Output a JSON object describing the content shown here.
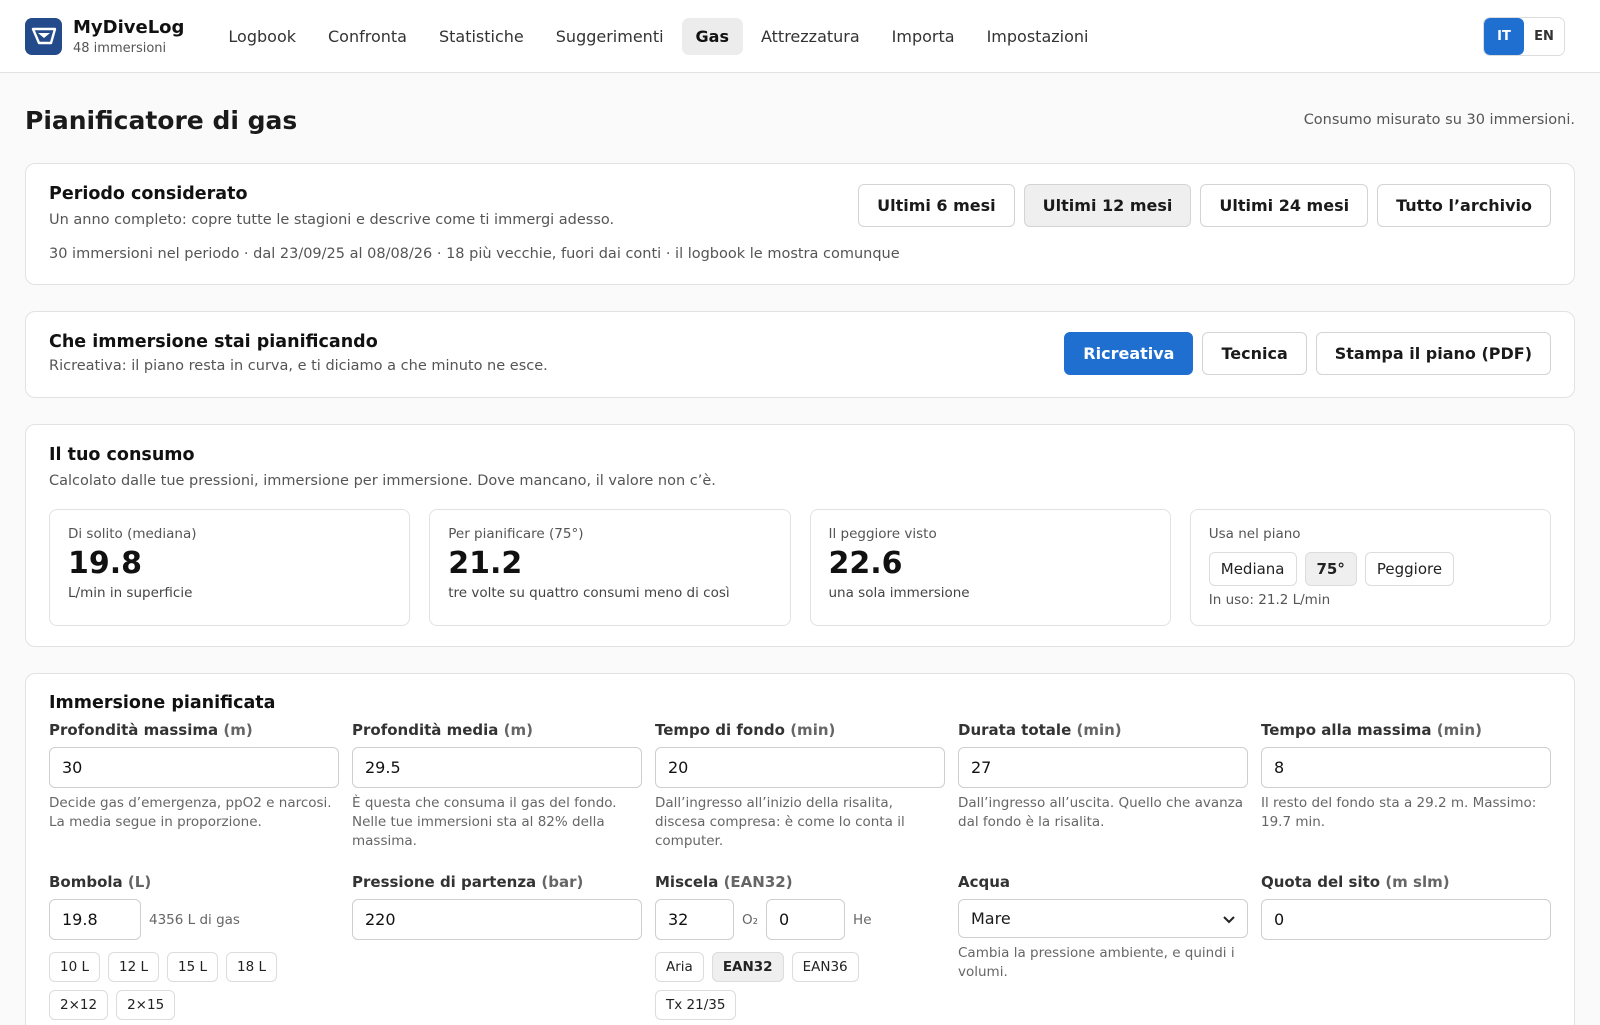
{
  "app": {
    "name": "MyDiveLog",
    "subtitle": "48 immersioni"
  },
  "nav": [
    "Logbook",
    "Confronta",
    "Statistiche",
    "Suggerimenti",
    "Gas",
    "Attrezzatura",
    "Importa",
    "Impostazioni"
  ],
  "nav_active": "Gas",
  "lang": {
    "it": "IT",
    "en": "EN",
    "active": "IT"
  },
  "page": {
    "title": "Pianificatore di gas",
    "note": "Consumo misurato su 30 immersioni."
  },
  "period": {
    "title": "Periodo considerato",
    "subtitle": "Un anno completo: copre tutte le stagioni e descrive come ti immergi adesso.",
    "options": [
      "Ultimi 6 mesi",
      "Ultimi 12 mesi",
      "Ultimi 24 mesi",
      "Tutto l’archivio"
    ],
    "selected": "Ultimi 12 mesi",
    "summary": "30 immersioni nel periodo · dal 23/09/25 al 08/08/26 · 18 più vecchie, fuori dai conti · il logbook le mostra comunque"
  },
  "dive_type": {
    "title": "Che immersione stai pianificando",
    "subtitle": "Ricreativa: il piano resta in curva, e ti diciamo a che minuto ne esce.",
    "recreational": "Ricreativa",
    "technical": "Tecnica",
    "print": "Stampa il piano (PDF)"
  },
  "consumption": {
    "title": "Il tuo consumo",
    "subtitle": "Calcolato dalle tue pressioni, immersione per immersione. Dove mancano, il valore non c’è.",
    "median": {
      "label": "Di solito (mediana)",
      "value": "19.8",
      "desc": "L/min in superficie"
    },
    "p75": {
      "label": "Per pianificare (75°)",
      "value": "21.2",
      "desc": "tre volte su quattro consumi meno di così"
    },
    "worst": {
      "label": "Il peggiore visto",
      "value": "22.6",
      "desc": "una sola immersione"
    },
    "use": {
      "label": "Usa nel piano",
      "options": [
        "Mediana",
        "75°",
        "Peggiore"
      ],
      "selected": "75°",
      "in_use": "In uso: 21.2 L/min"
    }
  },
  "plan": {
    "title": "Immersione pianificata",
    "max_depth": {
      "label": "Profondità massima",
      "unit": "(m)",
      "value": "30",
      "help": "Decide gas d’emergenza, ppO2 e narcosi. La media segue in proporzione."
    },
    "avg_depth": {
      "label": "Profondità media",
      "unit": "(m)",
      "value": "29.5",
      "help": "È questa che consuma il gas del fondo. Nelle tue immersioni sta al 82% della massima."
    },
    "bottom_time": {
      "label": "Tempo di fondo",
      "unit": "(min)",
      "value": "20",
      "help": "Dall’ingresso all’inizio della risalita, discesa compresa: è come lo conta il computer."
    },
    "total_time": {
      "label": "Durata totale",
      "unit": "(min)",
      "value": "27",
      "help": "Dall’ingresso all’uscita. Quello che avanza dal fondo è la risalita."
    },
    "time_at_max": {
      "label": "Tempo alla massima",
      "unit": "(min)",
      "value": "8",
      "help": "Il resto del fondo sta a 29.2 m. Massimo: 19.7 min."
    },
    "cylinder": {
      "label": "Bombola",
      "unit": "(L)",
      "value": "19.8",
      "gas_note": "4356 L di gas",
      "presets": [
        "10 L",
        "12 L",
        "15 L",
        "18 L",
        "2×12",
        "2×15"
      ]
    },
    "start_pressure": {
      "label": "Pressione di partenza",
      "unit": "(bar)",
      "value": "220"
    },
    "mix": {
      "label": "Miscela",
      "unit": "(EAN32)",
      "o2": "32",
      "o2_label": "O₂",
      "he": "0",
      "he_label": "He",
      "presets": [
        "Aria",
        "EAN32",
        "EAN36",
        "Tx 21/35"
      ],
      "selected": "EAN32"
    },
    "water": {
      "label": "Acqua",
      "value": "Mare",
      "help": "Cambia la pressione ambiente, e quindi i volumi."
    },
    "altitude": {
      "label": "Quota del sito",
      "unit": "(m slm)",
      "value": "0"
    }
  },
  "colors": {
    "accent": "#1f6fd1",
    "logo": "#234a8a"
  }
}
